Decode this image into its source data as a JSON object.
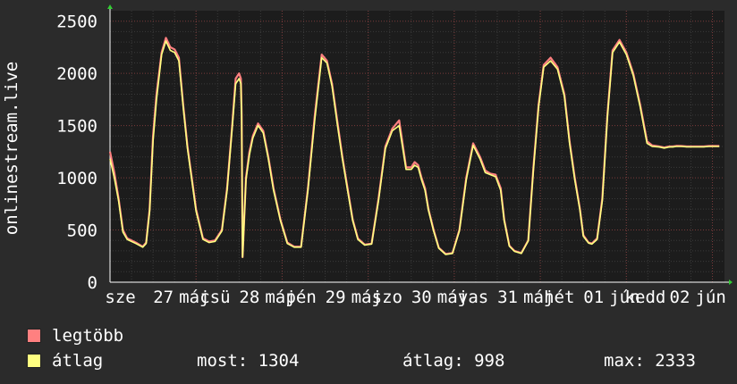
{
  "chart_data": {
    "type": "line",
    "ylabel": "onlinestream.live",
    "ylim": [
      0,
      2600
    ],
    "yticks": [
      0,
      500,
      1000,
      1500,
      2000,
      2500
    ],
    "ytick_labels": [
      "0",
      "500",
      "1000",
      "1500",
      "2000",
      "2500"
    ],
    "xlim": [
      0,
      7.14
    ],
    "xticks": [
      {
        "x": 0.12,
        "label": "sze"
      },
      {
        "x": 0.62,
        "label": "27"
      },
      {
        "x": 0.98,
        "label": "máj"
      },
      {
        "x": 1.22,
        "label": "csü"
      },
      {
        "x": 1.62,
        "label": "28"
      },
      {
        "x": 1.98,
        "label": "máj"
      },
      {
        "x": 2.22,
        "label": "pén"
      },
      {
        "x": 2.62,
        "label": "29"
      },
      {
        "x": 2.98,
        "label": "máj"
      },
      {
        "x": 3.22,
        "label": "szo"
      },
      {
        "x": 3.62,
        "label": "30"
      },
      {
        "x": 3.98,
        "label": "máj"
      },
      {
        "x": 4.22,
        "label": "vas"
      },
      {
        "x": 4.62,
        "label": "31"
      },
      {
        "x": 4.98,
        "label": "máj"
      },
      {
        "x": 5.22,
        "label": "hét"
      },
      {
        "x": 5.62,
        "label": "01"
      },
      {
        "x": 5.98,
        "label": "jún"
      },
      {
        "x": 6.22,
        "label": "kedd"
      },
      {
        "x": 6.62,
        "label": "02"
      },
      {
        "x": 6.98,
        "label": "jún"
      }
    ],
    "grid": true,
    "series": [
      {
        "name": "legtöbb",
        "color": "#ff8080",
        "x": [
          0,
          0.05,
          0.1,
          0.15,
          0.2,
          0.3,
          0.38,
          0.42,
          0.46,
          0.5,
          0.54,
          0.6,
          0.65,
          0.7,
          0.75,
          0.8,
          0.85,
          0.9,
          0.95,
          1.0,
          1.08,
          1.15,
          1.22,
          1.3,
          1.36,
          1.42,
          1.46,
          1.5,
          1.52,
          1.53,
          1.54,
          1.58,
          1.62,
          1.66,
          1.72,
          1.78,
          1.84,
          1.9,
          1.98,
          2.06,
          2.14,
          2.22,
          2.3,
          2.38,
          2.46,
          2.52,
          2.58,
          2.64,
          2.7,
          2.76,
          2.82,
          2.88,
          2.96,
          3.04,
          3.12,
          3.2,
          3.28,
          3.36,
          3.44,
          3.5,
          3.54,
          3.58,
          3.6,
          3.62,
          3.66,
          3.7,
          3.76,
          3.82,
          3.9,
          3.98,
          4.06,
          4.14,
          4.22,
          4.3,
          4.36,
          4.42,
          4.48,
          4.54,
          4.58,
          4.64,
          4.7,
          4.78,
          4.86,
          4.92,
          4.98,
          5.04,
          5.12,
          5.2,
          5.28,
          5.34,
          5.4,
          5.46,
          5.5,
          5.56,
          5.6,
          5.66,
          5.72,
          5.78,
          5.84,
          5.92,
          6.0,
          6.08,
          6.16,
          6.24,
          6.3,
          6.38,
          6.44,
          6.5,
          6.54,
          6.58,
          6.64,
          6.7,
          6.78,
          6.84,
          6.9,
          6.96,
          7.02,
          7.05,
          7.08
        ],
        "values": [
          1250,
          1050,
          800,
          500,
          420,
          380,
          340,
          380,
          700,
          1400,
          1800,
          2200,
          2340,
          2250,
          2230,
          2150,
          1700,
          1300,
          1000,
          700,
          420,
          390,
          400,
          500,
          900,
          1500,
          1950,
          2000,
          1950,
          1600,
          240,
          1000,
          1250,
          1400,
          1520,
          1450,
          1200,
          900,
          600,
          380,
          340,
          340,
          900,
          1600,
          2180,
          2120,
          1900,
          1550,
          1200,
          900,
          600,
          420,
          360,
          370,
          800,
          1300,
          1470,
          1550,
          1100,
          1100,
          1150,
          1120,
          1060,
          1000,
          900,
          700,
          500,
          330,
          270,
          280,
          500,
          1000,
          1330,
          1200,
          1070,
          1040,
          1030,
          900,
          600,
          350,
          300,
          280,
          400,
          1100,
          1700,
          2080,
          2150,
          2060,
          1800,
          1350,
          1000,
          700,
          450,
          380,
          370,
          420,
          800,
          1600,
          2220,
          2320,
          2200,
          2000,
          1700,
          1350,
          1310,
          1300,
          1290,
          1300,
          1300,
          1305,
          1304,
          1300,
          1300,
          1300,
          1300,
          1304,
          1304,
          1304,
          1304
        ]
      },
      {
        "name": "átlag",
        "color": "#ffff80",
        "x": [
          0,
          0.05,
          0.1,
          0.15,
          0.2,
          0.3,
          0.38,
          0.42,
          0.46,
          0.5,
          0.54,
          0.6,
          0.65,
          0.7,
          0.75,
          0.8,
          0.85,
          0.9,
          0.95,
          1.0,
          1.08,
          1.15,
          1.22,
          1.3,
          1.36,
          1.42,
          1.46,
          1.5,
          1.52,
          1.53,
          1.54,
          1.58,
          1.62,
          1.66,
          1.72,
          1.78,
          1.84,
          1.9,
          1.98,
          2.06,
          2.14,
          2.22,
          2.3,
          2.38,
          2.46,
          2.52,
          2.58,
          2.64,
          2.7,
          2.76,
          2.82,
          2.88,
          2.96,
          3.04,
          3.12,
          3.2,
          3.28,
          3.36,
          3.44,
          3.5,
          3.54,
          3.58,
          3.6,
          3.62,
          3.66,
          3.7,
          3.76,
          3.82,
          3.9,
          3.98,
          4.06,
          4.14,
          4.22,
          4.3,
          4.36,
          4.42,
          4.48,
          4.54,
          4.58,
          4.64,
          4.7,
          4.78,
          4.86,
          4.92,
          4.98,
          5.04,
          5.12,
          5.2,
          5.28,
          5.34,
          5.4,
          5.46,
          5.5,
          5.56,
          5.6,
          5.66,
          5.72,
          5.78,
          5.84,
          5.92,
          6.0,
          6.08,
          6.16,
          6.24,
          6.3,
          6.38,
          6.44,
          6.5,
          6.54,
          6.58,
          6.64,
          6.7,
          6.78,
          6.84,
          6.9,
          6.96,
          7.02,
          7.05,
          7.08
        ],
        "values": [
          1180,
          1000,
          780,
          480,
          410,
          370,
          335,
          370,
          680,
          1350,
          1750,
          2180,
          2310,
          2220,
          2200,
          2120,
          1680,
          1280,
          980,
          680,
          410,
          380,
          390,
          490,
          880,
          1480,
          1900,
          1950,
          1900,
          1550,
          240,
          980,
          1220,
          1380,
          1500,
          1430,
          1180,
          880,
          590,
          370,
          335,
          335,
          880,
          1560,
          2150,
          2100,
          1880,
          1520,
          1180,
          880,
          590,
          410,
          355,
          365,
          780,
          1280,
          1450,
          1500,
          1080,
          1080,
          1120,
          1100,
          1040,
          980,
          880,
          690,
          490,
          325,
          265,
          275,
          490,
          980,
          1310,
          1180,
          1050,
          1030,
          1010,
          880,
          590,
          345,
          295,
          275,
          395,
          1080,
          1680,
          2060,
          2120,
          2040,
          1780,
          1330,
          980,
          690,
          440,
          375,
          365,
          410,
          780,
          1580,
          2200,
          2300,
          2180,
          1980,
          1680,
          1330,
          1300,
          1295,
          1285,
          1295,
          1295,
          1300,
          1300,
          1296,
          1296,
          1296,
          1296,
          1300,
          1300,
          1300,
          1300
        ]
      }
    ]
  },
  "legend": {
    "max_label": "legtöbb",
    "avg_label": "átlag",
    "now_text": "most: 1304",
    "avg_text": "átlag: 998",
    "max_text": "max: 2333",
    "max_color": "#ff8080",
    "avg_color": "#ffff80"
  }
}
